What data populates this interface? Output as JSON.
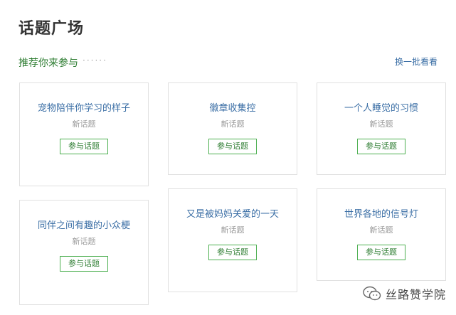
{
  "header": {
    "title": "话题广场",
    "recommend_label": "推荐你来参与",
    "dots": "······",
    "refresh_label": "换一批看看"
  },
  "cards": [
    {
      "title": "宠物陪伴你学习的样子",
      "tag": "新话题",
      "button": "参与话题"
    },
    {
      "title": "徽章收集控",
      "tag": "新话题",
      "button": "参与话题"
    },
    {
      "title": "一个人睡觉的习惯",
      "tag": "新话题",
      "button": "参与话题"
    },
    {
      "title": "同伴之间有趣的小众梗",
      "tag": "新话题",
      "button": "参与话题"
    },
    {
      "title": "又是被妈妈关爱的一天",
      "tag": "新话题",
      "button": "参与话题"
    },
    {
      "title": "世界各地的信号灯",
      "tag": "新话题",
      "button": "参与话题"
    }
  ],
  "watermark": {
    "text": "丝路赞学院",
    "icon": "wechat-icon"
  }
}
